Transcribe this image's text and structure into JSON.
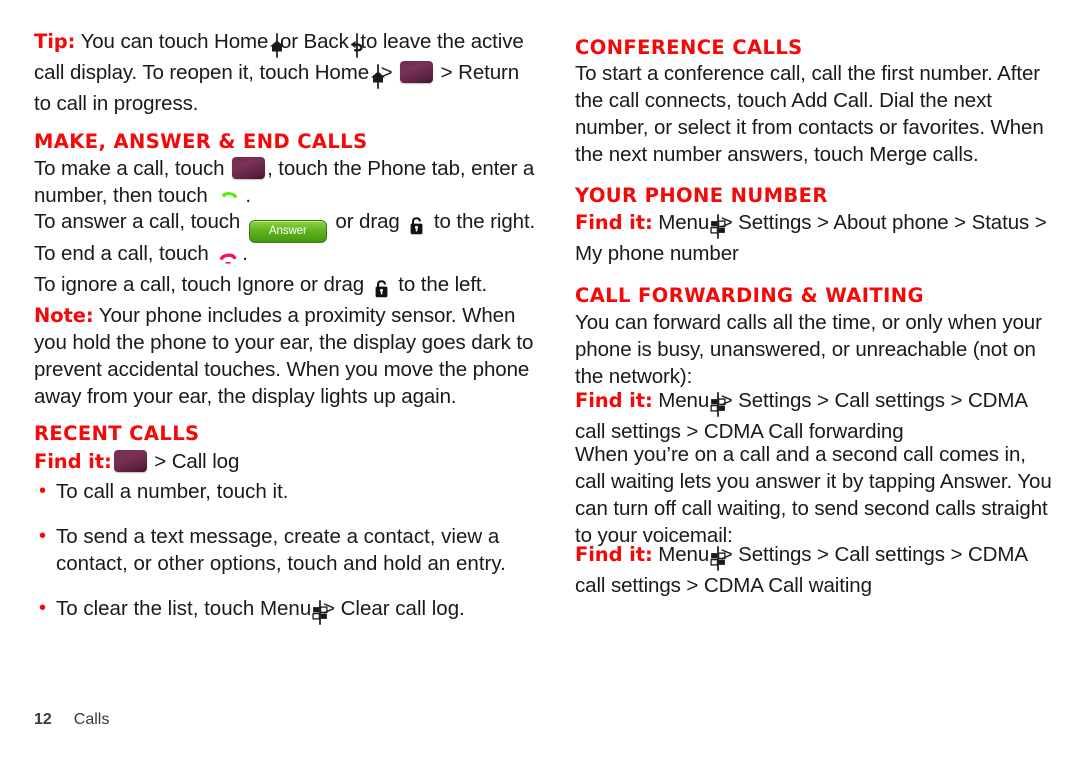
{
  "page": {
    "number": "12",
    "section": "Calls"
  },
  "colors": {
    "heading_red": "#f50808",
    "body_text": "#1a1a1a",
    "app_icon_maroon": "#6d2d52",
    "answer_green": "#62b520",
    "end_call_red": "#f5175c",
    "footer_gray": "#3a3a3a"
  },
  "left_column": {
    "tip": {
      "label": "Tip:",
      "text_1": " You can touch Home ",
      "icon_1": "home-icon",
      "text_2": " or Back ",
      "icon_2": "back-icon",
      "text_3": " to leave the active call display. To reopen it, touch Home ",
      "icon_3": "home-icon",
      "text_4": " > ",
      "icon_4": "dialer-app-icon",
      "text_5": " > Return to call in progress."
    },
    "make_answer_end": {
      "heading": "Make, answer & end calls",
      "line_1_a": "To make a call, touch ",
      "line_1_icon": "dialer-app-icon",
      "line_1_b": ", touch the Phone tab, enter a number, then touch ",
      "line_1_icon2": "green-phone-icon",
      "line_1_c": ".",
      "line_2_a": "To answer a call, touch ",
      "line_2_button": "Answer",
      "line_2_b": " or drag ",
      "line_2_icon": "lock-icon",
      "line_2_c": " to the right.",
      "line_3_a": "To end a call, touch ",
      "line_3_icon": "red-end-call-icon",
      "line_3_b": ".",
      "line_4_a": "To ignore a call, touch Ignore or drag ",
      "line_4_icon": "lock-icon",
      "line_4_b": " to the left.",
      "note_label": "Note:",
      "note_text": " Your phone includes a proximity sensor. When you hold the phone to your ear, the display goes dark to prevent accidental touches. When you move the phone away from your ear, the display lights up again."
    },
    "recent_calls": {
      "heading": "Recent calls",
      "find_it_label": "Find it:",
      "find_it_icon": "dialer-app-icon",
      "find_it_path": " > Call log",
      "bullets": [
        {
          "text": "To call a number, touch it."
        },
        {
          "text": "To send a text message, create a contact, view a contact, or other options, touch and hold an entry."
        },
        {
          "text_a": "To clear the list, touch Menu ",
          "icon": "menu-icon",
          "text_b": " > Clear call log."
        }
      ]
    }
  },
  "right_column": {
    "conference_calls": {
      "heading": "Conference calls",
      "body": "To start a conference call, call the first number. After the call connects, touch Add Call. Dial the next number, or select it from contacts or favorites. When the next number answers, touch Merge calls."
    },
    "your_phone_number": {
      "heading": "Your phone number",
      "find_it_label": "Find it:",
      "find_it_a": " Menu ",
      "find_it_icon": "menu-icon",
      "find_it_b": " > Settings > About phone > Status > My phone number"
    },
    "call_forwarding_waiting": {
      "heading": "Call forwarding & waiting",
      "body_1": "You can forward calls all the time, or only when your phone is busy, unanswered, or unreachable (not on the network):",
      "find_it_1_label": "Find it:",
      "find_it_1_a": " Menu ",
      "find_it_1_icon": "menu-icon",
      "find_it_1_b": " > Settings > Call settings > CDMA call settings > CDMA Call forwarding",
      "body_2": "When you’re on a call and a second call comes in, call waiting lets you answer it by tapping Answer. You can turn off call waiting, to send second calls straight to your voicemail:",
      "find_it_2_label": "Find it:",
      "find_it_2_a": " Menu ",
      "find_it_2_icon": "menu-icon",
      "find_it_2_b": " > Settings > Call settings > CDMA call settings > CDMA Call waiting"
    }
  }
}
